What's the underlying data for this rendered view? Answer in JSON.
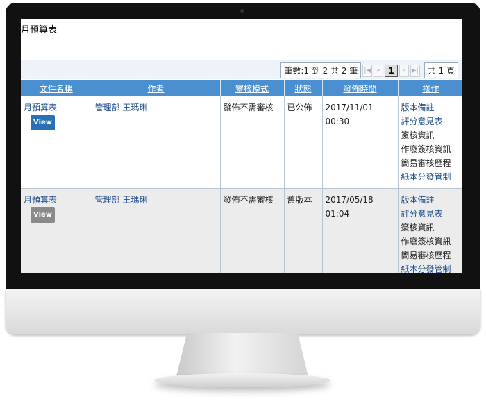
{
  "page": {
    "title": "月預算表"
  },
  "pager": {
    "count_label": "筆數:1 到 2 共 2 筆",
    "current_page": "1",
    "total_label": "共 1 頁"
  },
  "table": {
    "headers": [
      "文件名稱",
      "作者",
      "審核模式",
      "狀態",
      "發佈時間",
      "操作"
    ],
    "rows": [
      {
        "name": "月預算表",
        "badge": "View",
        "badge_color": "#2a6fb8",
        "author": "管理部 王瑪琍",
        "mode": "發佈不需審核",
        "status": "已公佈",
        "date": "2017/11/01",
        "time": "00:30",
        "ops": [
          "版本備註",
          "評分意見表",
          "簽核資訊",
          "作廢簽核資訊",
          "簡易審核歷程",
          "紙本分發管制"
        ]
      },
      {
        "name": "月預算表",
        "badge": "View",
        "badge_color": "#8a8a8a",
        "author": "管理部 王瑪琍",
        "mode": "發佈不需審核",
        "status": "舊版本",
        "date": "2017/05/18",
        "time": "01:04",
        "ops": [
          "版本備註",
          "評分意見表",
          "簽核資訊",
          "作廢簽核資訊",
          "簡易審核歷程",
          "紙本分發管制"
        ]
      }
    ]
  },
  "colors": {
    "header_bg": "#4a8fcf",
    "link": "#1e4d8c",
    "old_row_bg": "#ececec"
  }
}
